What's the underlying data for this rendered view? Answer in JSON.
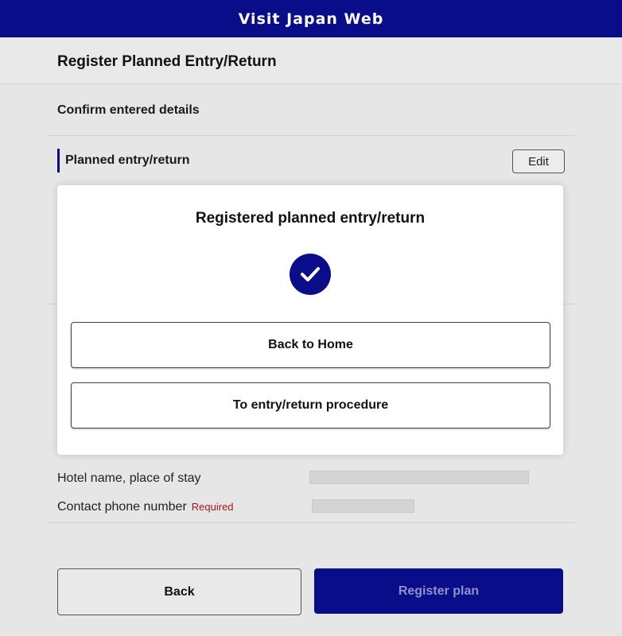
{
  "app": {
    "title": "Visit Japan Web"
  },
  "page": {
    "title": "Register Planned Entry/Return",
    "section_title": "Confirm entered details",
    "subheading": "Planned entry/return",
    "edit_label": "Edit"
  },
  "details": {
    "hotel_label": "Hotel name, place of stay",
    "phone_label": "Contact phone number",
    "phone_required": "Required"
  },
  "footer": {
    "back_label": "Back",
    "register_label": "Register plan"
  },
  "modal": {
    "title": "Registered planned entry/return",
    "icon": "check-circle-icon",
    "back_home_label": "Back to Home",
    "procedure_label": "To entry/return procedure"
  },
  "colors": {
    "brand": "#0a0d8a",
    "required": "#a01818"
  }
}
